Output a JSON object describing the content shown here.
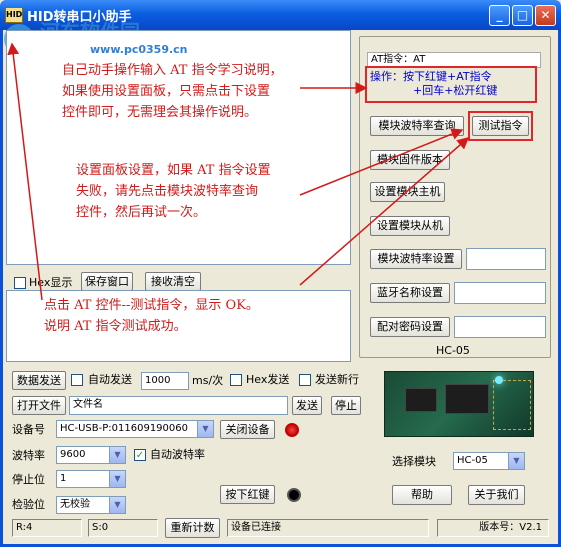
{
  "window": {
    "title": "HID转串口小助手",
    "icon_text": "HID"
  },
  "watermark": {
    "site": "河东软件园",
    "url": "www.pc0359.cn"
  },
  "receive_area": {
    "annotation_1": [
      "自己动手操作输入 AT 指令学习说明，",
      "如果使用设置面板，只需点击下设置",
      "控件即可，无需理会其操作说明。"
    ],
    "annotation_2": [
      "设置面板设置，如果 AT 指令设置",
      "失败，请先点击模块波特率查询",
      "控件，然后再试一次。"
    ]
  },
  "receive_toolbar": {
    "hex_display": "Hex显示",
    "save_window": "保存窗口",
    "clear_receive": "接收清空"
  },
  "send_area": {
    "annotation": [
      "点击 AT 控件--测试指令，显示 OK。",
      "说明 AT 指令测试成功。"
    ]
  },
  "settings_panel": {
    "at_label": "AT指令：AT",
    "op_line1": "操作：按下红键+AT指令",
    "op_line2": "+回车+松开红键",
    "buttons": {
      "baud_query": "模块波特率查询",
      "test": "测试指令",
      "firmware": "模块固件版本",
      "set_master": "设置模块主机",
      "set_slave": "设置模块从机",
      "set_baud": "模块波特率设置",
      "set_name": "蓝牙名称设置",
      "set_pin": "配对密码设置"
    },
    "module_caption": "HC-05"
  },
  "send_row": {
    "send_data": "数据发送",
    "auto_send": "自动发送",
    "interval": "1000",
    "unit": "ms/次",
    "hex_send": "Hex发送",
    "send_newline": "发送新行"
  },
  "file_row": {
    "open_file": "打开文件",
    "file_name": "文件名",
    "send": "发送",
    "stop": "停止"
  },
  "device_row": {
    "label": "设备号",
    "value": "HC-USB-P:011609190060",
    "close_device": "关闭设备"
  },
  "baud_row": {
    "label": "波特率",
    "value": "9600",
    "auto_baud": "自动波特率"
  },
  "stopbit_row": {
    "label": "停止位",
    "value": "1"
  },
  "parity_row": {
    "label": "检验位",
    "value": "无校验",
    "press_red": "按下红键"
  },
  "module_select": {
    "label": "选择模块",
    "value": "HC-05",
    "help": "帮助",
    "about": "关于我们"
  },
  "status_bar": {
    "rx": "R:4",
    "tx": "S:0",
    "reset_count": "重新计数",
    "status": "设备已连接",
    "version_label": "版本号：",
    "version": "V2.1"
  },
  "colors": {
    "title_bar": "#0a5fe0",
    "annotation_red": "#d21a1a",
    "window_bg": "#ece9d8"
  }
}
